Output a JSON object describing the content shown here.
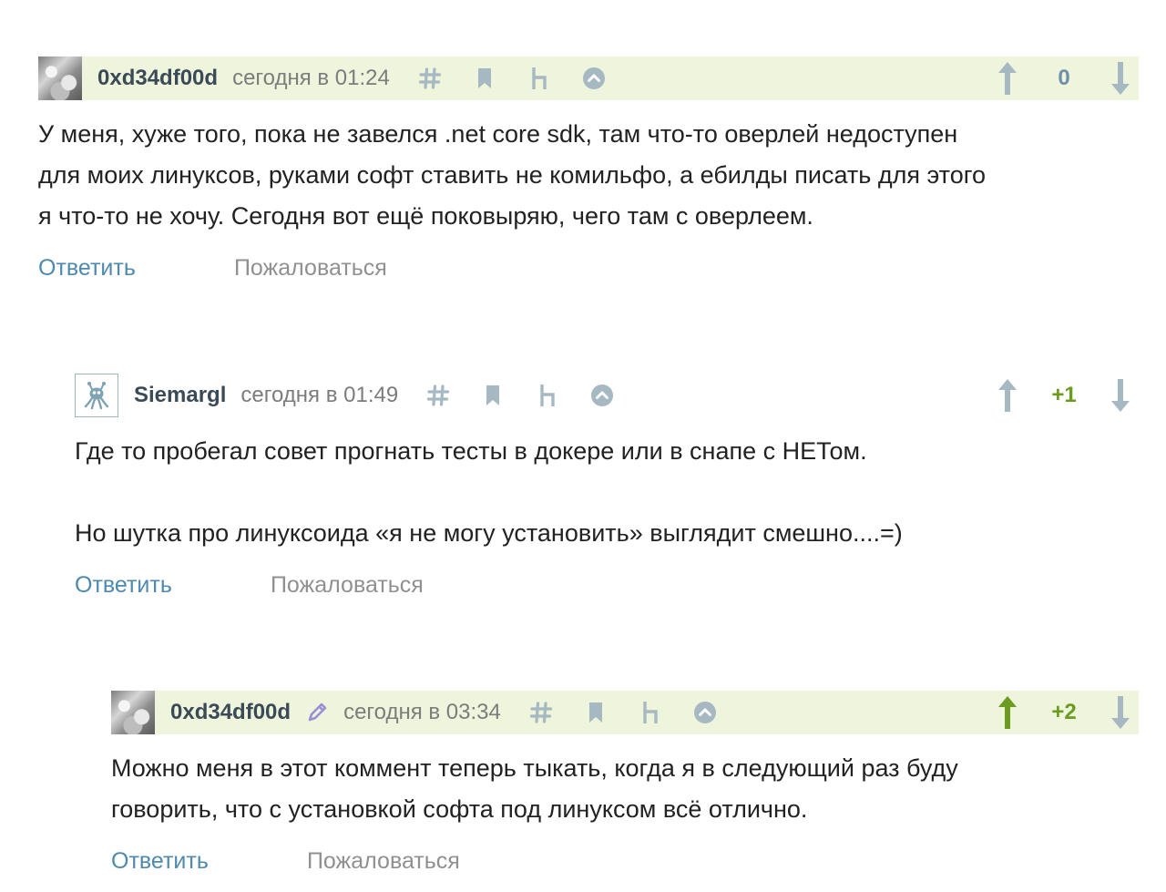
{
  "comments": [
    {
      "username": "0xd34df00d",
      "time": "сегодня в 01:24",
      "score": "0",
      "lines": [
        "У меня, хуже того, пока не завелся .net core sdk, там что-то оверлей недоступен",
        "для моих линуксов, руками софт ставить не комильфо, а ебилды писать для этого",
        "я что-то не хочу. Сегодня вот ещё поковыряю, чего там с оверлеем."
      ],
      "reply_label": "Ответить",
      "report_label": "Пожаловаться"
    },
    {
      "username": "Siemargl",
      "time": "сегодня в 01:49",
      "score": "+1",
      "paragraphs": [
        "Где то пробегал совет прогнать тесты в докере или в снапе с НЕТом.",
        "Но шутка про линуксоида «я не могу установить» выглядит смешно....=)"
      ],
      "reply_label": "Ответить",
      "report_label": "Пожаловаться"
    },
    {
      "username": "0xd34df00d",
      "time": "сегодня в 03:34",
      "score": "+2",
      "lines": [
        "Можно меня в этот коммент теперь тыкать, когда я в следующий раз буду",
        "говорить, что с установкой софта под линуксом всё отлично."
      ],
      "reply_label": "Ответить",
      "report_label": "Пожаловаться"
    }
  ],
  "colors": {
    "highlight_bg": "#eef5dc",
    "icon_gray": "#a6b8c2",
    "upvoted_green": "#6b9b1f",
    "link_blue": "#4e89ae",
    "edit_icon": "#9a8fd6"
  },
  "icons": [
    "hash-icon",
    "bookmark-icon",
    "parent-comment-icon",
    "scroll-up-icon",
    "upvote-arrow-icon",
    "downvote-arrow-icon",
    "edit-pencil-icon"
  ]
}
